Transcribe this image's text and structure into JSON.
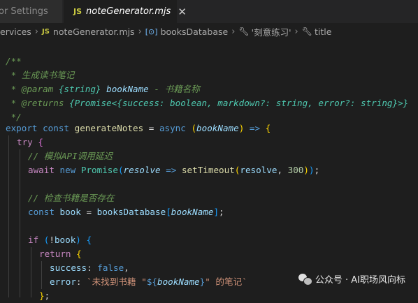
{
  "tabs": {
    "inactive_label": "or Settings",
    "active_badge": "JS",
    "active_label": "noteGenerator.mjs",
    "close_glyph": "✕"
  },
  "breadcrumb": {
    "items": [
      "ervices",
      "noteGenerator.mjs",
      "booksDatabase",
      "'刻意练习'",
      "title"
    ],
    "js_badge": "JS",
    "sep": "›"
  },
  "code": {
    "c_open": "/**",
    "c_desc": " * 生成读书笔记",
    "c_param_tag": " * @param",
    "c_param_type": "{string}",
    "c_param_name": "bookName",
    "c_param_desc": " - 书籍名称",
    "c_ret_tag": " * @returns",
    "c_ret_type": "{Promise<{success: boolean, markdown?: string, error?: string}>}",
    "c_close": " */",
    "l_export": "export",
    "l_const": "const",
    "l_fn": "generateNotes",
    "l_async": "async",
    "l_param": "bookName",
    "l_arrow": "=>",
    "try": "try",
    "cm_sim": "// 模拟API调用延迟",
    "await": "await",
    "new": "new",
    "promise": "Promise",
    "resolve": "resolve",
    "setTimeout": "setTimeout",
    "num300": "300",
    "cm_check": "// 检查书籍是否存在",
    "book": "book",
    "booksDatabase": "booksDatabase",
    "if": "if",
    "return": "return",
    "success": "success",
    "false": "false",
    "error": "error",
    "tpl_a": "`未找到书籍 \"",
    "tpl_b": "\" 的笔记`"
  },
  "watermark": {
    "text": "公众号 · AI职场风向标"
  },
  "colors": {
    "background": "#1e1e1e",
    "comment": "#6a9955",
    "keyword": "#569cd6",
    "control": "#c586c0",
    "function": "#dcdcaa",
    "variable": "#9cdcfe",
    "string": "#ce9178",
    "number": "#b5cea8"
  }
}
